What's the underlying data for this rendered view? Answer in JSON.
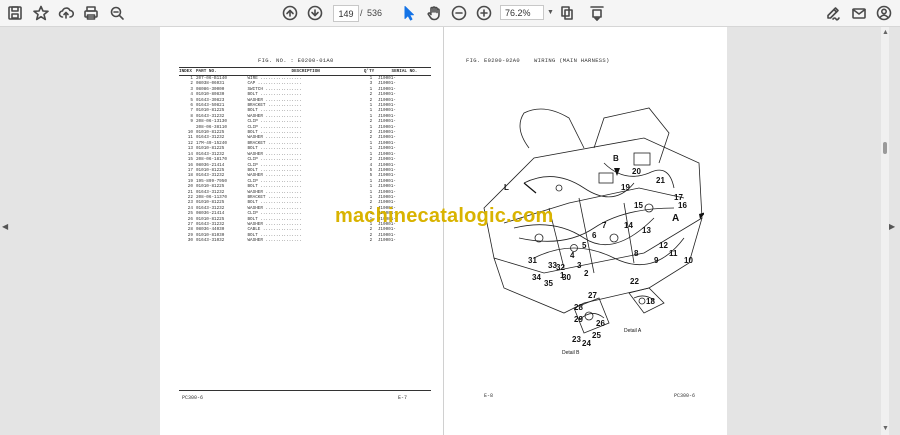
{
  "toolbar": {
    "page_current": "149",
    "page_separator": "/",
    "page_total": "536",
    "zoom": "76.2%",
    "icons": [
      "save-icon",
      "star-icon",
      "cloud-upload-icon",
      "print-icon",
      "search-icon",
      "arrow-up-icon",
      "arrow-down-icon",
      "cursor-icon",
      "hand-icon",
      "zoom-out-icon",
      "zoom-in-icon",
      "fit-page-icon",
      "scroll-mode-icon",
      "sign-icon",
      "mail-icon",
      "account-icon"
    ]
  },
  "left_page": {
    "fig_title": "FIG. NO. : E0200-01A0",
    "headers": [
      "INDEX",
      "PART NO.",
      "DESCRIPTION",
      "Q'TY",
      "SERIAL NO."
    ],
    "rows": [
      {
        "idx": "1",
        "part": "207-06-B1140",
        "desc": "WIRE ................",
        "qty": "1",
        "serial": "J10001-"
      },
      {
        "idx": "2",
        "part": "08038-06031",
        "desc": "CAP .................",
        "qty": "3",
        "serial": "J10001-"
      },
      {
        "idx": "3",
        "part": "08086-30000",
        "desc": "SWITCH ..............",
        "qty": "1",
        "serial": "J10001-"
      },
      {
        "idx": "4",
        "part": "01010-80830",
        "desc": "BOLT ................",
        "qty": "2",
        "serial": "J10001-"
      },
      {
        "idx": "5",
        "part": "01643-30823",
        "desc": "WASHER ..............",
        "qty": "2",
        "serial": "J10001-"
      },
      {
        "idx": "6",
        "part": "01643-50821",
        "desc": "BRACKET .............",
        "qty": "1",
        "serial": "J10001-"
      },
      {
        "idx": "7",
        "part": "01010-81225",
        "desc": "BOLT ................",
        "qty": "1",
        "serial": "J10001-"
      },
      {
        "idx": "8",
        "part": "01643-31232",
        "desc": "WASHER ..............",
        "qty": "1",
        "serial": "J10001-"
      },
      {
        "idx": "9",
        "part": "208-06-13130",
        "desc": "CLIP ................",
        "qty": "2",
        "serial": "J10001-"
      },
      {
        "idx": "",
        "part": "208-06-38110",
        "desc": "CLIP ................",
        "qty": "1",
        "serial": "J10001-"
      },
      {
        "idx": "10",
        "part": "01010-81225",
        "desc": "BOLT ................",
        "qty": "2",
        "serial": "J10001-"
      },
      {
        "idx": "11",
        "part": "01643-31232",
        "desc": "WASHER ..............",
        "qty": "2",
        "serial": "J10001-"
      },
      {
        "idx": "12",
        "part": "17M-49-15240",
        "desc": "BRACKET .............",
        "qty": "1",
        "serial": "J10001-"
      },
      {
        "idx": "13",
        "part": "01010-81225",
        "desc": "BOLT ................",
        "qty": "1",
        "serial": "J10001-"
      },
      {
        "idx": "14",
        "part": "01643-31232",
        "desc": "WASHER ..............",
        "qty": "1",
        "serial": "J10001-"
      },
      {
        "idx": "15",
        "part": "208-06-18170",
        "desc": "CLIP ................",
        "qty": "2",
        "serial": "J10001-"
      },
      {
        "idx": "16",
        "part": "08036-21414",
        "desc": "CLIP ................",
        "qty": "4",
        "serial": "J10001-"
      },
      {
        "idx": "17",
        "part": "01010-81225",
        "desc": "BOLT ................",
        "qty": "5",
        "serial": "J10001-"
      },
      {
        "idx": "18",
        "part": "01643-31232",
        "desc": "WASHER ..............",
        "qty": "5",
        "serial": "J10001-"
      },
      {
        "idx": "19",
        "part": "195-899-7950",
        "desc": "CLIP ................",
        "qty": "1",
        "serial": "J10001-"
      },
      {
        "idx": "20",
        "part": "01010-81225",
        "desc": "BOLT ................",
        "qty": "1",
        "serial": "J10001-"
      },
      {
        "idx": "21",
        "part": "01643-31232",
        "desc": "WASHER ..............",
        "qty": "1",
        "serial": "J10001-"
      },
      {
        "idx": "22",
        "part": "208-06-11370",
        "desc": "BRACKET .............",
        "qty": "1",
        "serial": "J10001-"
      },
      {
        "idx": "23",
        "part": "01010-81225",
        "desc": "BOLT ................",
        "qty": "2",
        "serial": "J10001-"
      },
      {
        "idx": "24",
        "part": "01643-31232",
        "desc": "WASHER ..............",
        "qty": "2",
        "serial": "J10001-"
      },
      {
        "idx": "25",
        "part": "08036-21414",
        "desc": "CLIP ................",
        "qty": "1",
        "serial": "J10001-"
      },
      {
        "idx": "26",
        "part": "01010-81225",
        "desc": "BOLT ................",
        "qty": "1",
        "serial": "J10001-"
      },
      {
        "idx": "27",
        "part": "01643-31232",
        "desc": "WASHER ..............",
        "qty": "1",
        "serial": "J10001-"
      },
      {
        "idx": "28",
        "part": "08036-44030",
        "desc": "CABLE ...............",
        "qty": "2",
        "serial": "J10001-"
      },
      {
        "idx": "29",
        "part": "01010-81030",
        "desc": "BOLT ................",
        "qty": "2",
        "serial": "J10001-"
      },
      {
        "idx": "30",
        "part": "01643-31032",
        "desc": "WASHER ..............",
        "qty": "2",
        "serial": "J10001-"
      }
    ],
    "footer_left": "PC300-6",
    "footer_right": "E-7"
  },
  "right_page": {
    "fig_title": "FIG. E0200-02A0",
    "fig_subtitle": "WIRING (MAIN HARNESS)",
    "callouts": [
      "L",
      "B",
      "A",
      "21",
      "20",
      "19",
      "15",
      "16",
      "17",
      "14",
      "13",
      "12",
      "11",
      "10",
      "9",
      "8",
      "7",
      "6",
      "5",
      "4",
      "3",
      "2",
      "1",
      "33",
      "32",
      "31",
      "34",
      "35",
      "30",
      "27",
      "28",
      "29",
      "26",
      "25",
      "24",
      "23",
      "22",
      "18"
    ],
    "detail_a": "Detail A",
    "detail_b": "Detail B",
    "footer_left": "E-8",
    "footer_right": "PC300-6"
  },
  "watermark": "machinecatalogic.com",
  "colors": {
    "accent": "#1473e6",
    "watermark": "#d9b300",
    "viewer_bg": "#e4e4e4"
  }
}
